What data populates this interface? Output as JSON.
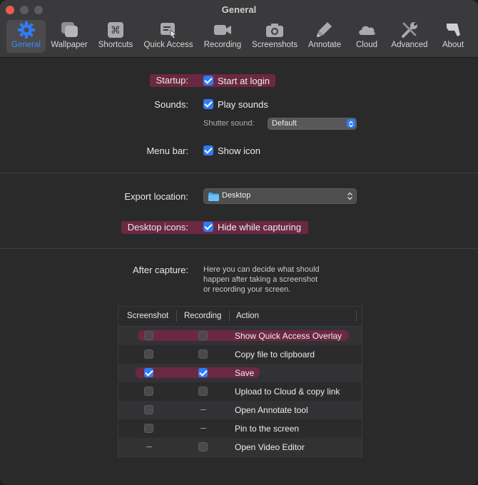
{
  "window": {
    "title": "General"
  },
  "tabs": [
    {
      "label": "General",
      "icon": "gear-icon"
    },
    {
      "label": "Wallpaper",
      "icon": "wallpaper-icon"
    },
    {
      "label": "Shortcuts",
      "icon": "command-key-icon"
    },
    {
      "label": "Quick Access",
      "icon": "quick-access-icon"
    },
    {
      "label": "Recording",
      "icon": "video-camera-icon"
    },
    {
      "label": "Screenshots",
      "icon": "camera-icon"
    },
    {
      "label": "Annotate",
      "icon": "marker-icon"
    },
    {
      "label": "Cloud",
      "icon": "cloud-icon"
    },
    {
      "label": "Advanced",
      "icon": "tools-icon"
    },
    {
      "label": "About",
      "icon": "about-icon"
    }
  ],
  "startup": {
    "label": "Startup:",
    "option": "Start at login",
    "checked": true
  },
  "sounds": {
    "label": "Sounds:",
    "option": "Play sounds",
    "checked": true,
    "shutter_label": "Shutter sound:",
    "shutter_value": "Default"
  },
  "menubar": {
    "label": "Menu bar:",
    "option": "Show icon",
    "checked": true
  },
  "export": {
    "label": "Export location:",
    "value": "Desktop"
  },
  "desktop_icons": {
    "label": "Desktop icons:",
    "option": "Hide while capturing",
    "checked": true
  },
  "after_capture": {
    "label": "After capture:",
    "description": [
      "Here you can decide what should",
      "happen after taking a screenshot",
      "or recording your screen."
    ],
    "columns": [
      "Screenshot",
      "Recording",
      "Action"
    ],
    "rows": [
      {
        "screenshot": "off",
        "recording": "off",
        "action": "Show Quick Access Overlay",
        "highlight": true
      },
      {
        "screenshot": "off",
        "recording": "off",
        "action": "Copy file to clipboard",
        "highlight": false
      },
      {
        "screenshot": "on",
        "recording": "on",
        "action": "Save",
        "highlight": true
      },
      {
        "screenshot": "off",
        "recording": "off",
        "action": "Upload to Cloud & copy link",
        "highlight": false
      },
      {
        "screenshot": "off",
        "recording": "none",
        "action": "Open Annotate tool",
        "highlight": false
      },
      {
        "screenshot": "off",
        "recording": "none",
        "action": "Pin to the screen",
        "highlight": false
      },
      {
        "screenshot": "none",
        "recording": "off",
        "action": "Open Video Editor",
        "highlight": false
      }
    ]
  },
  "colors": {
    "accent": "#2f7cf6",
    "highlight": "#6b2842",
    "background": "#2a2a2b"
  }
}
